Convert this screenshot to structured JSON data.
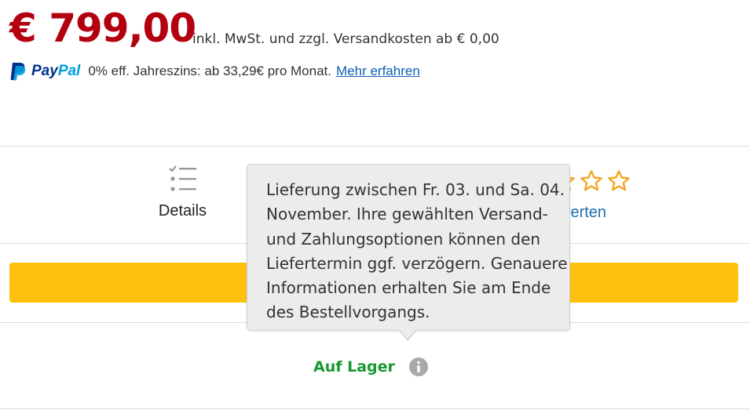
{
  "price": {
    "amount": "€ 799,00",
    "tax_note": "inkl. MwSt. und zzgl. Versandkosten ab € 0,00"
  },
  "paypal": {
    "brand_pay": "Pay",
    "brand_pal": "Pal",
    "financing_text": "0% eff. Jahreszins: ab 33,29€ pro Monat.",
    "learn_more_link": "Mehr erfahren"
  },
  "actions": {
    "details_label": "Details",
    "details_icon": "checklist-icon",
    "rating_label_visible": "werten",
    "star_icon": "star-outline-icon",
    "star_color": "#f5a623"
  },
  "tooltip": {
    "lines": [
      "Lieferung zwischen Fr. 03. und Sa. 04.",
      "November. Ihre gewählten Versand-",
      "und Zahlungsoptionen können den",
      "Liefertermin ggf. verzögern. Genauere",
      "Informationen erhalten Sie am Ende",
      "des Bestellvorgangs."
    ]
  },
  "stock": {
    "label": "Auf Lager",
    "info_icon": "info-icon"
  },
  "colors": {
    "price": "#b3000f",
    "cta_button": "#fdc10e",
    "stock_green": "#17992e",
    "link_blue": "#0b5eb8"
  }
}
